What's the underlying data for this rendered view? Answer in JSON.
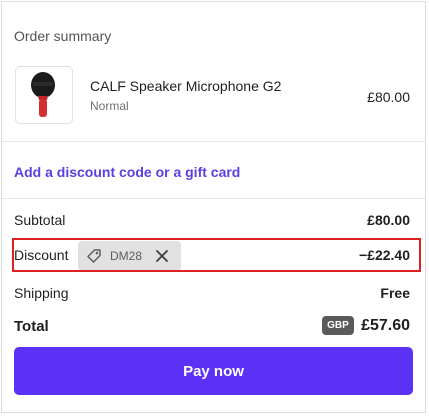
{
  "summary": {
    "title": "Order summary"
  },
  "product": {
    "image_icon": "microphone-image",
    "name": "CALF Speaker Microphone G2",
    "variant": "Normal",
    "price": "£80.00"
  },
  "discount_link": "Add a discount code or a gift card",
  "rows": {
    "subtotal_label": "Subtotal",
    "subtotal_value": "£80.00",
    "discount_label": "Discount",
    "discount_code": "DM28",
    "discount_value": "−£22.40",
    "shipping_label": "Shipping",
    "shipping_value": "Free"
  },
  "total": {
    "label": "Total",
    "currency": "GBP",
    "value": "£57.60"
  },
  "pay_button": "Pay now",
  "colors": {
    "accent": "#5b32f5",
    "link": "#5b3fe0",
    "highlight": "#e02020",
    "chip_bg": "#e1e1e1"
  },
  "icons": {
    "tag": "tag-icon",
    "remove": "close-icon"
  }
}
